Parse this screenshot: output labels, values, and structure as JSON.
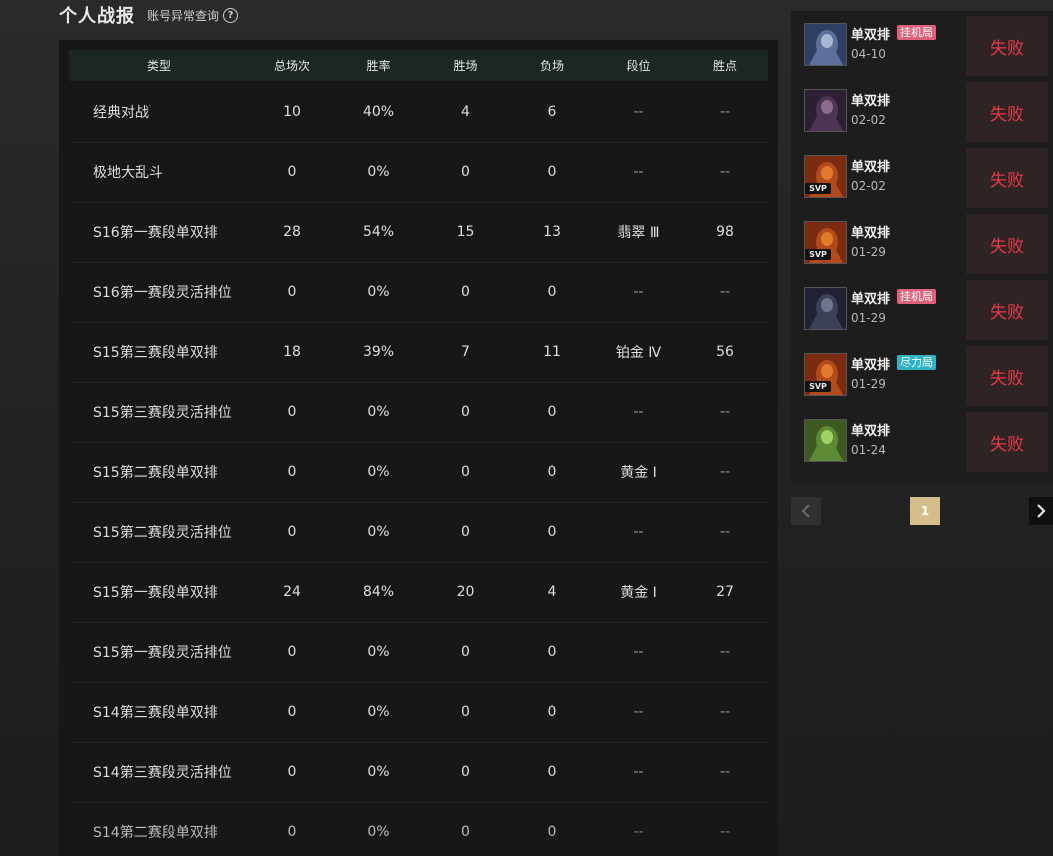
{
  "header": {
    "title": "个人战报",
    "account_link": "账号异常查询",
    "help_glyph": "?"
  },
  "table": {
    "columns": [
      "类型",
      "总场次",
      "胜率",
      "胜场",
      "负场",
      "段位",
      "胜点"
    ],
    "rows": [
      [
        "经典对战",
        "10",
        "40%",
        "4",
        "6",
        "--",
        "--"
      ],
      [
        "极地大乱斗",
        "0",
        "0%",
        "0",
        "0",
        "--",
        "--"
      ],
      [
        "S16第一赛段单双排",
        "28",
        "54%",
        "15",
        "13",
        "翡翠 Ⅲ",
        "98"
      ],
      [
        "S16第一赛段灵活排位",
        "0",
        "0%",
        "0",
        "0",
        "--",
        "--"
      ],
      [
        "S15第三赛段单双排",
        "18",
        "39%",
        "7",
        "11",
        "铂金 Ⅳ",
        "56"
      ],
      [
        "S15第三赛段灵活排位",
        "0",
        "0%",
        "0",
        "0",
        "--",
        "--"
      ],
      [
        "S15第二赛段单双排",
        "0",
        "0%",
        "0",
        "0",
        "黄金 Ⅰ",
        "--"
      ],
      [
        "S15第二赛段灵活排位",
        "0",
        "0%",
        "0",
        "0",
        "--",
        "--"
      ],
      [
        "S15第一赛段单双排",
        "24",
        "84%",
        "20",
        "4",
        "黄金 Ⅰ",
        "27"
      ],
      [
        "S15第一赛段灵活排位",
        "0",
        "0%",
        "0",
        "0",
        "--",
        "--"
      ],
      [
        "S14第三赛段单双排",
        "0",
        "0%",
        "0",
        "0",
        "--",
        "--"
      ],
      [
        "S14第三赛段灵活排位",
        "0",
        "0%",
        "0",
        "0",
        "--",
        "--"
      ],
      [
        "S14第二赛段单双排",
        "0",
        "0%",
        "0",
        "0",
        "--",
        "--"
      ]
    ]
  },
  "matches": [
    {
      "mode": "单双排",
      "tag": "挂机局",
      "tag_color": "#e0607a",
      "date": "04-10",
      "result": "失败",
      "svp": "",
      "avatar_colors": [
        "#2e3f63",
        "#a9b6d6",
        "#5f6f9c"
      ]
    },
    {
      "mode": "单双排",
      "tag": "",
      "tag_color": "",
      "date": "02-02",
      "result": "失败",
      "svp": "",
      "avatar_colors": [
        "#2c1f33",
        "#8c6b8f",
        "#4b3552"
      ]
    },
    {
      "mode": "单双排",
      "tag": "",
      "tag_color": "",
      "date": "02-02",
      "result": "失败",
      "svp": "SVP",
      "avatar_colors": [
        "#7a2b10",
        "#e07a2c",
        "#b34a1c"
      ]
    },
    {
      "mode": "单双排",
      "tag": "",
      "tag_color": "",
      "date": "01-29",
      "result": "失败",
      "svp": "SVP",
      "avatar_colors": [
        "#7a2b10",
        "#e07a2c",
        "#b34a1c"
      ]
    },
    {
      "mode": "单双排",
      "tag": "挂机局",
      "tag_color": "#e0607a",
      "date": "01-29",
      "result": "失败",
      "svp": "",
      "avatar_colors": [
        "#1f2233",
        "#6f7690",
        "#3b3f57"
      ]
    },
    {
      "mode": "单双排",
      "tag": "尽力局",
      "tag_color": "#2eb3c9",
      "date": "01-29",
      "result": "失败",
      "svp": "SVP",
      "avatar_colors": [
        "#7a2b10",
        "#e07a2c",
        "#b34a1c"
      ]
    },
    {
      "mode": "单双排",
      "tag": "",
      "tag_color": "",
      "date": "01-24",
      "result": "失败",
      "svp": "",
      "avatar_colors": [
        "#3d5a22",
        "#9fd36a",
        "#5f8a35"
      ]
    }
  ],
  "pagination": {
    "prev_icon": "chevron-left-icon",
    "current_page": "1",
    "next_icon": "chevron-right-icon"
  }
}
